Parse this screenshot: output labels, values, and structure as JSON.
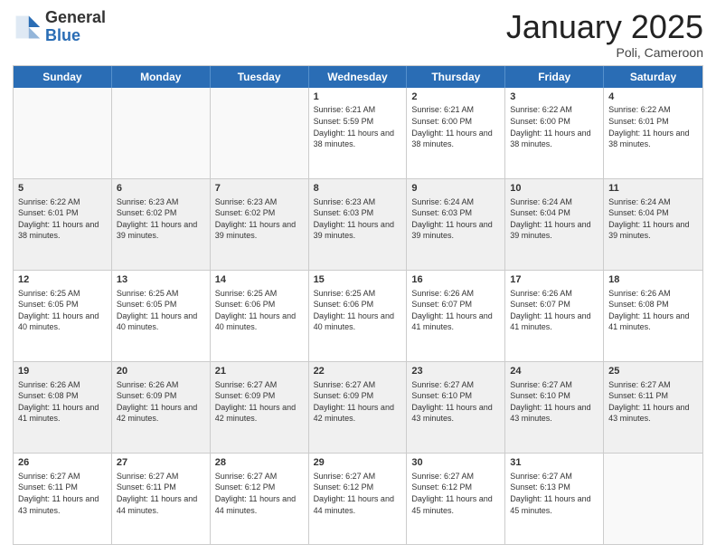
{
  "logo": {
    "general": "General",
    "blue": "Blue"
  },
  "header": {
    "month": "January 2025",
    "location": "Poli, Cameroon"
  },
  "dayHeaders": [
    "Sunday",
    "Monday",
    "Tuesday",
    "Wednesday",
    "Thursday",
    "Friday",
    "Saturday"
  ],
  "weeks": [
    [
      {
        "day": "",
        "info": "",
        "empty": true
      },
      {
        "day": "",
        "info": "",
        "empty": true
      },
      {
        "day": "",
        "info": "",
        "empty": true
      },
      {
        "day": "1",
        "info": "Sunrise: 6:21 AM\nSunset: 5:59 PM\nDaylight: 11 hours and 38 minutes."
      },
      {
        "day": "2",
        "info": "Sunrise: 6:21 AM\nSunset: 6:00 PM\nDaylight: 11 hours and 38 minutes."
      },
      {
        "day": "3",
        "info": "Sunrise: 6:22 AM\nSunset: 6:00 PM\nDaylight: 11 hours and 38 minutes."
      },
      {
        "day": "4",
        "info": "Sunrise: 6:22 AM\nSunset: 6:01 PM\nDaylight: 11 hours and 38 minutes."
      }
    ],
    [
      {
        "day": "5",
        "info": "Sunrise: 6:22 AM\nSunset: 6:01 PM\nDaylight: 11 hours and 38 minutes."
      },
      {
        "day": "6",
        "info": "Sunrise: 6:23 AM\nSunset: 6:02 PM\nDaylight: 11 hours and 39 minutes."
      },
      {
        "day": "7",
        "info": "Sunrise: 6:23 AM\nSunset: 6:02 PM\nDaylight: 11 hours and 39 minutes."
      },
      {
        "day": "8",
        "info": "Sunrise: 6:23 AM\nSunset: 6:03 PM\nDaylight: 11 hours and 39 minutes."
      },
      {
        "day": "9",
        "info": "Sunrise: 6:24 AM\nSunset: 6:03 PM\nDaylight: 11 hours and 39 minutes."
      },
      {
        "day": "10",
        "info": "Sunrise: 6:24 AM\nSunset: 6:04 PM\nDaylight: 11 hours and 39 minutes."
      },
      {
        "day": "11",
        "info": "Sunrise: 6:24 AM\nSunset: 6:04 PM\nDaylight: 11 hours and 39 minutes."
      }
    ],
    [
      {
        "day": "12",
        "info": "Sunrise: 6:25 AM\nSunset: 6:05 PM\nDaylight: 11 hours and 40 minutes."
      },
      {
        "day": "13",
        "info": "Sunrise: 6:25 AM\nSunset: 6:05 PM\nDaylight: 11 hours and 40 minutes."
      },
      {
        "day": "14",
        "info": "Sunrise: 6:25 AM\nSunset: 6:06 PM\nDaylight: 11 hours and 40 minutes."
      },
      {
        "day": "15",
        "info": "Sunrise: 6:25 AM\nSunset: 6:06 PM\nDaylight: 11 hours and 40 minutes."
      },
      {
        "day": "16",
        "info": "Sunrise: 6:26 AM\nSunset: 6:07 PM\nDaylight: 11 hours and 41 minutes."
      },
      {
        "day": "17",
        "info": "Sunrise: 6:26 AM\nSunset: 6:07 PM\nDaylight: 11 hours and 41 minutes."
      },
      {
        "day": "18",
        "info": "Sunrise: 6:26 AM\nSunset: 6:08 PM\nDaylight: 11 hours and 41 minutes."
      }
    ],
    [
      {
        "day": "19",
        "info": "Sunrise: 6:26 AM\nSunset: 6:08 PM\nDaylight: 11 hours and 41 minutes."
      },
      {
        "day": "20",
        "info": "Sunrise: 6:26 AM\nSunset: 6:09 PM\nDaylight: 11 hours and 42 minutes."
      },
      {
        "day": "21",
        "info": "Sunrise: 6:27 AM\nSunset: 6:09 PM\nDaylight: 11 hours and 42 minutes."
      },
      {
        "day": "22",
        "info": "Sunrise: 6:27 AM\nSunset: 6:09 PM\nDaylight: 11 hours and 42 minutes."
      },
      {
        "day": "23",
        "info": "Sunrise: 6:27 AM\nSunset: 6:10 PM\nDaylight: 11 hours and 43 minutes."
      },
      {
        "day": "24",
        "info": "Sunrise: 6:27 AM\nSunset: 6:10 PM\nDaylight: 11 hours and 43 minutes."
      },
      {
        "day": "25",
        "info": "Sunrise: 6:27 AM\nSunset: 6:11 PM\nDaylight: 11 hours and 43 minutes."
      }
    ],
    [
      {
        "day": "26",
        "info": "Sunrise: 6:27 AM\nSunset: 6:11 PM\nDaylight: 11 hours and 43 minutes."
      },
      {
        "day": "27",
        "info": "Sunrise: 6:27 AM\nSunset: 6:11 PM\nDaylight: 11 hours and 44 minutes."
      },
      {
        "day": "28",
        "info": "Sunrise: 6:27 AM\nSunset: 6:12 PM\nDaylight: 11 hours and 44 minutes."
      },
      {
        "day": "29",
        "info": "Sunrise: 6:27 AM\nSunset: 6:12 PM\nDaylight: 11 hours and 44 minutes."
      },
      {
        "day": "30",
        "info": "Sunrise: 6:27 AM\nSunset: 6:12 PM\nDaylight: 11 hours and 45 minutes."
      },
      {
        "day": "31",
        "info": "Sunrise: 6:27 AM\nSunset: 6:13 PM\nDaylight: 11 hours and 45 minutes."
      },
      {
        "day": "",
        "info": "",
        "empty": true
      }
    ]
  ]
}
